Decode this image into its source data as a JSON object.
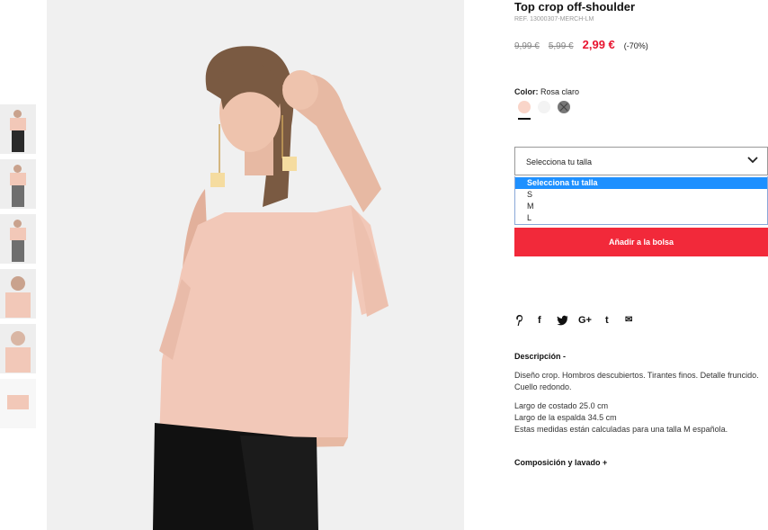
{
  "product": {
    "title": "Top crop off-shoulder",
    "ref": "REF. 13000307-MERCH-LM",
    "prices": {
      "old_1": "9,99 €",
      "old_2": "5,99 €",
      "sale": "2,99 €",
      "discount": "(-70%)"
    },
    "color": {
      "label": "Color:",
      "value": "Rosa claro",
      "swatches": [
        {
          "name": "rosa-claro",
          "hex": "#f9d5c9",
          "selected": true
        },
        {
          "name": "blanco",
          "hex": "#f3f3f3",
          "selected": false
        },
        {
          "name": "gris",
          "hex": "#777777",
          "selected": false,
          "unavailable": true
        }
      ]
    },
    "size_select": {
      "placeholder": "Selecciona tu talla",
      "options": [
        "Selecciona tu talla",
        "S",
        "M",
        "L"
      ],
      "highlighted_option": "Selecciona tu talla"
    },
    "add_to_bag": "Añadir a la bolsa",
    "social": [
      {
        "icon": "pinterest-icon",
        "glyph": "P"
      },
      {
        "icon": "facebook-icon",
        "glyph": "f"
      },
      {
        "icon": "twitter-icon",
        "glyph": "t"
      },
      {
        "icon": "google-plus-icon",
        "glyph": "G+"
      },
      {
        "icon": "tumblr-icon",
        "glyph": "t"
      },
      {
        "icon": "email-icon",
        "glyph": "✉"
      }
    ],
    "description": {
      "heading": "Descripción -",
      "p1": "Diseño crop. Hombros descubiertos. Tirantes finos. Detalle fruncido. Cuello redondo.",
      "lines": [
        "Largo de costado 25.0 cm",
        "Largo de la espalda 34.5 cm",
        "Estas medidas están calculadas para una talla M española."
      ]
    },
    "composition_heading": "Composición y lavado +"
  },
  "colors": {
    "accent": "#f2293a",
    "sale_price": "#e8142f",
    "dropdown_highlight": "#1e90ff",
    "top_garment": "#f2c8b8",
    "pants": "#111111"
  },
  "gallery": {
    "thumbnails": [
      "thumb-front-black-pants",
      "thumb-full-grey-pants",
      "thumb-full-grey-pants-2",
      "thumb-closeup",
      "thumb-detail",
      "thumb-product-only"
    ]
  }
}
